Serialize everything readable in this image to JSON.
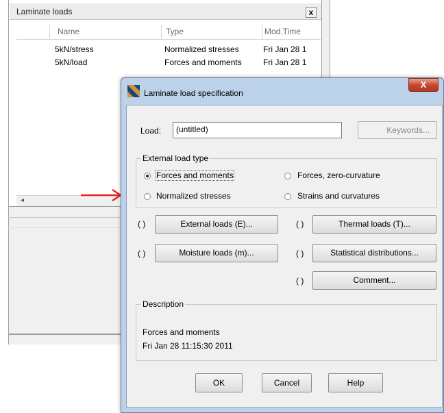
{
  "background_window": {
    "title": "Laminate loads",
    "close_label": "x",
    "columns": [
      "Name",
      "Type",
      "Mod.Time"
    ],
    "rows": [
      {
        "name": "5kN/stress",
        "type": "Normalized stresses",
        "mod_time": "Fri Jan 28 1"
      },
      {
        "name": "5kN/load",
        "type": "Forces and moments",
        "mod_time": "Fri Jan 28 1"
      }
    ],
    "scroll_left_glyph": "◂"
  },
  "dialog": {
    "title": "Laminate load specification",
    "close_label": "X",
    "load_label": "Load:",
    "load_value": "(untitled)",
    "keywords_button": "Keywords...",
    "external_load_type": {
      "title": "External load type",
      "options": [
        {
          "label": "Forces and moments",
          "selected": true
        },
        {
          "label": "Forces, zero-curvature",
          "selected": false
        },
        {
          "label": "Normalized stresses",
          "selected": false
        },
        {
          "label": "Strains and curvatures",
          "selected": false
        }
      ]
    },
    "paren_marker": "( )",
    "buttons": {
      "external_loads": "External loads (E)...",
      "thermal_loads": "Thermal loads (T)...",
      "moisture_loads": "Moisture loads (m)...",
      "statistical": "Statistical distributions...",
      "comment": "Comment..."
    },
    "description": {
      "title": "Description",
      "line1": "Forces and moments",
      "line2": "Fri Jan 28 11:15:30 2011"
    },
    "footer": {
      "ok": "OK",
      "cancel": "Cancel",
      "help": "Help"
    }
  },
  "colors": {
    "arrow": "#e8221f",
    "dialog_frame": "#bcd2ea",
    "close_button": "#c7432b"
  }
}
